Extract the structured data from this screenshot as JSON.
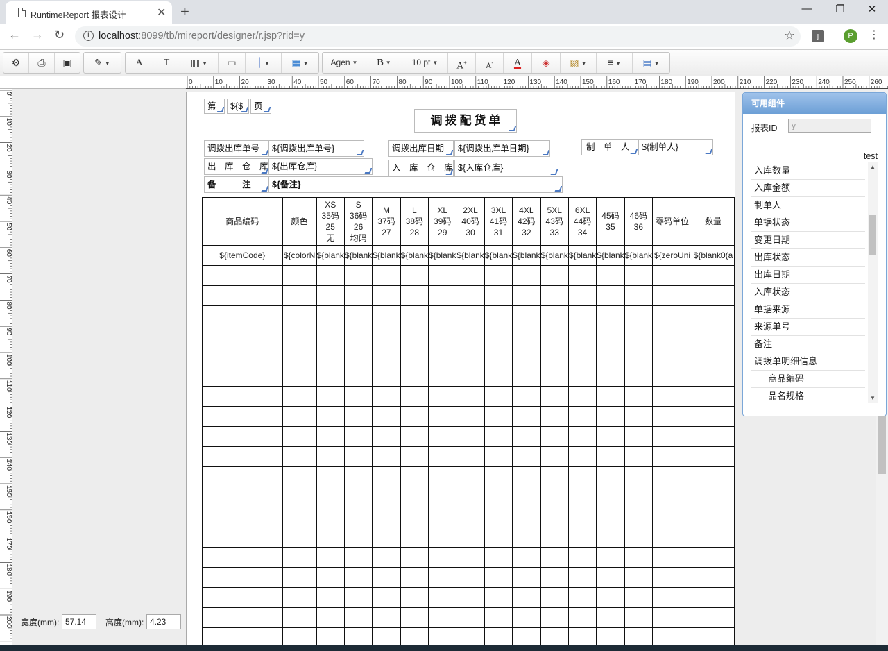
{
  "browser": {
    "tab_title": "RuntimeReport 报表设计",
    "url_host": "localhost",
    "url_rest": ":8099/tb/mireport/designer/r.jsp?rid=y",
    "avatar": "P",
    "extension": "j"
  },
  "toolbar": {
    "font_name": "Agen",
    "font_size": "10 pt",
    "btn_a": "A",
    "btn_t": "T",
    "btn_bold": "B"
  },
  "ruler": {
    "h_ticks": [
      "0",
      "10",
      "20",
      "30",
      "40",
      "50",
      "60",
      "70",
      "80",
      "90",
      "100",
      "110",
      "120",
      "130",
      "140",
      "150",
      "160",
      "170",
      "180",
      "190",
      "200",
      "210",
      "220",
      "230",
      "240",
      "250",
      "260"
    ],
    "v_ticks": [
      "0",
      "10",
      "20",
      "30",
      "40",
      "50",
      "60",
      "70",
      "80",
      "90",
      "100",
      "110",
      "120",
      "130",
      "140",
      "150",
      "160",
      "170",
      "180",
      "190",
      "200"
    ]
  },
  "report": {
    "page_no_prefix": "第",
    "page_no_value": "${$",
    "page_no_suffix": "页",
    "title": "调拨配货单",
    "fields": {
      "out_no_label": "调拨出库单号",
      "out_no_value": "${调拨出库单号}",
      "out_date_label": "调拨出库日期",
      "out_date_value": "${调拨出库单日期}",
      "maker_label": "制　单　人",
      "maker_value": "${制单人}",
      "out_wh_label": "出　库　仓　库",
      "out_wh_value": "${出库仓库}",
      "in_wh_label": "入　库　仓　库",
      "in_wh_value": "${入库仓库}",
      "remark_label": "备　　　注",
      "remark_value": "${备注}"
    },
    "table_headers": [
      "商品编码",
      "颜色",
      "XS 35码 25 无",
      "S 36码 26 均码",
      "M 37码 27",
      "L 38码 28",
      "XL 39码 29",
      "2XL 40码 30",
      "3XL 41码 31",
      "4XL 42码 32",
      "5XL 43码 33",
      "6XL 44码 34",
      "45码 35",
      "46码 36",
      "零码单位",
      "数量"
    ],
    "binding_row": [
      "${itemCode}",
      "${colorN",
      "${blank",
      "${blank",
      "${blank",
      "${blank",
      "${blank",
      "${blank",
      "${blank",
      "${blank",
      "${blank",
      "${blank",
      "${blank",
      "${blank",
      "${zeroUni",
      "${blank0(a"
    ]
  },
  "size_panel": {
    "width_label": "宽度(mm):",
    "width_value": "57.14",
    "height_label": "高度(mm):",
    "height_value": "4.23"
  },
  "components_panel": {
    "title": "可用组件",
    "report_id_label": "报表ID",
    "report_id_placeholder": "y",
    "dataset_name": "test",
    "items": [
      {
        "label": "入库数量",
        "child": false
      },
      {
        "label": "入库金额",
        "child": false
      },
      {
        "label": "制单人",
        "child": false
      },
      {
        "label": "单据状态",
        "child": false
      },
      {
        "label": "变更日期",
        "child": false
      },
      {
        "label": "出库状态",
        "child": false
      },
      {
        "label": "出库日期",
        "child": false
      },
      {
        "label": "入库状态",
        "child": false
      },
      {
        "label": "单据来源",
        "child": false
      },
      {
        "label": "来源单号",
        "child": false
      },
      {
        "label": "备注",
        "child": false
      },
      {
        "label": "调拨单明细信息",
        "child": false
      },
      {
        "label": "商品编码",
        "child": true
      },
      {
        "label": "品名规格",
        "child": true
      }
    ]
  },
  "colors": {
    "panel_header": "#6c9fd6",
    "canvas_bg": "#ededed",
    "resize_handle": "#4a78c2"
  }
}
